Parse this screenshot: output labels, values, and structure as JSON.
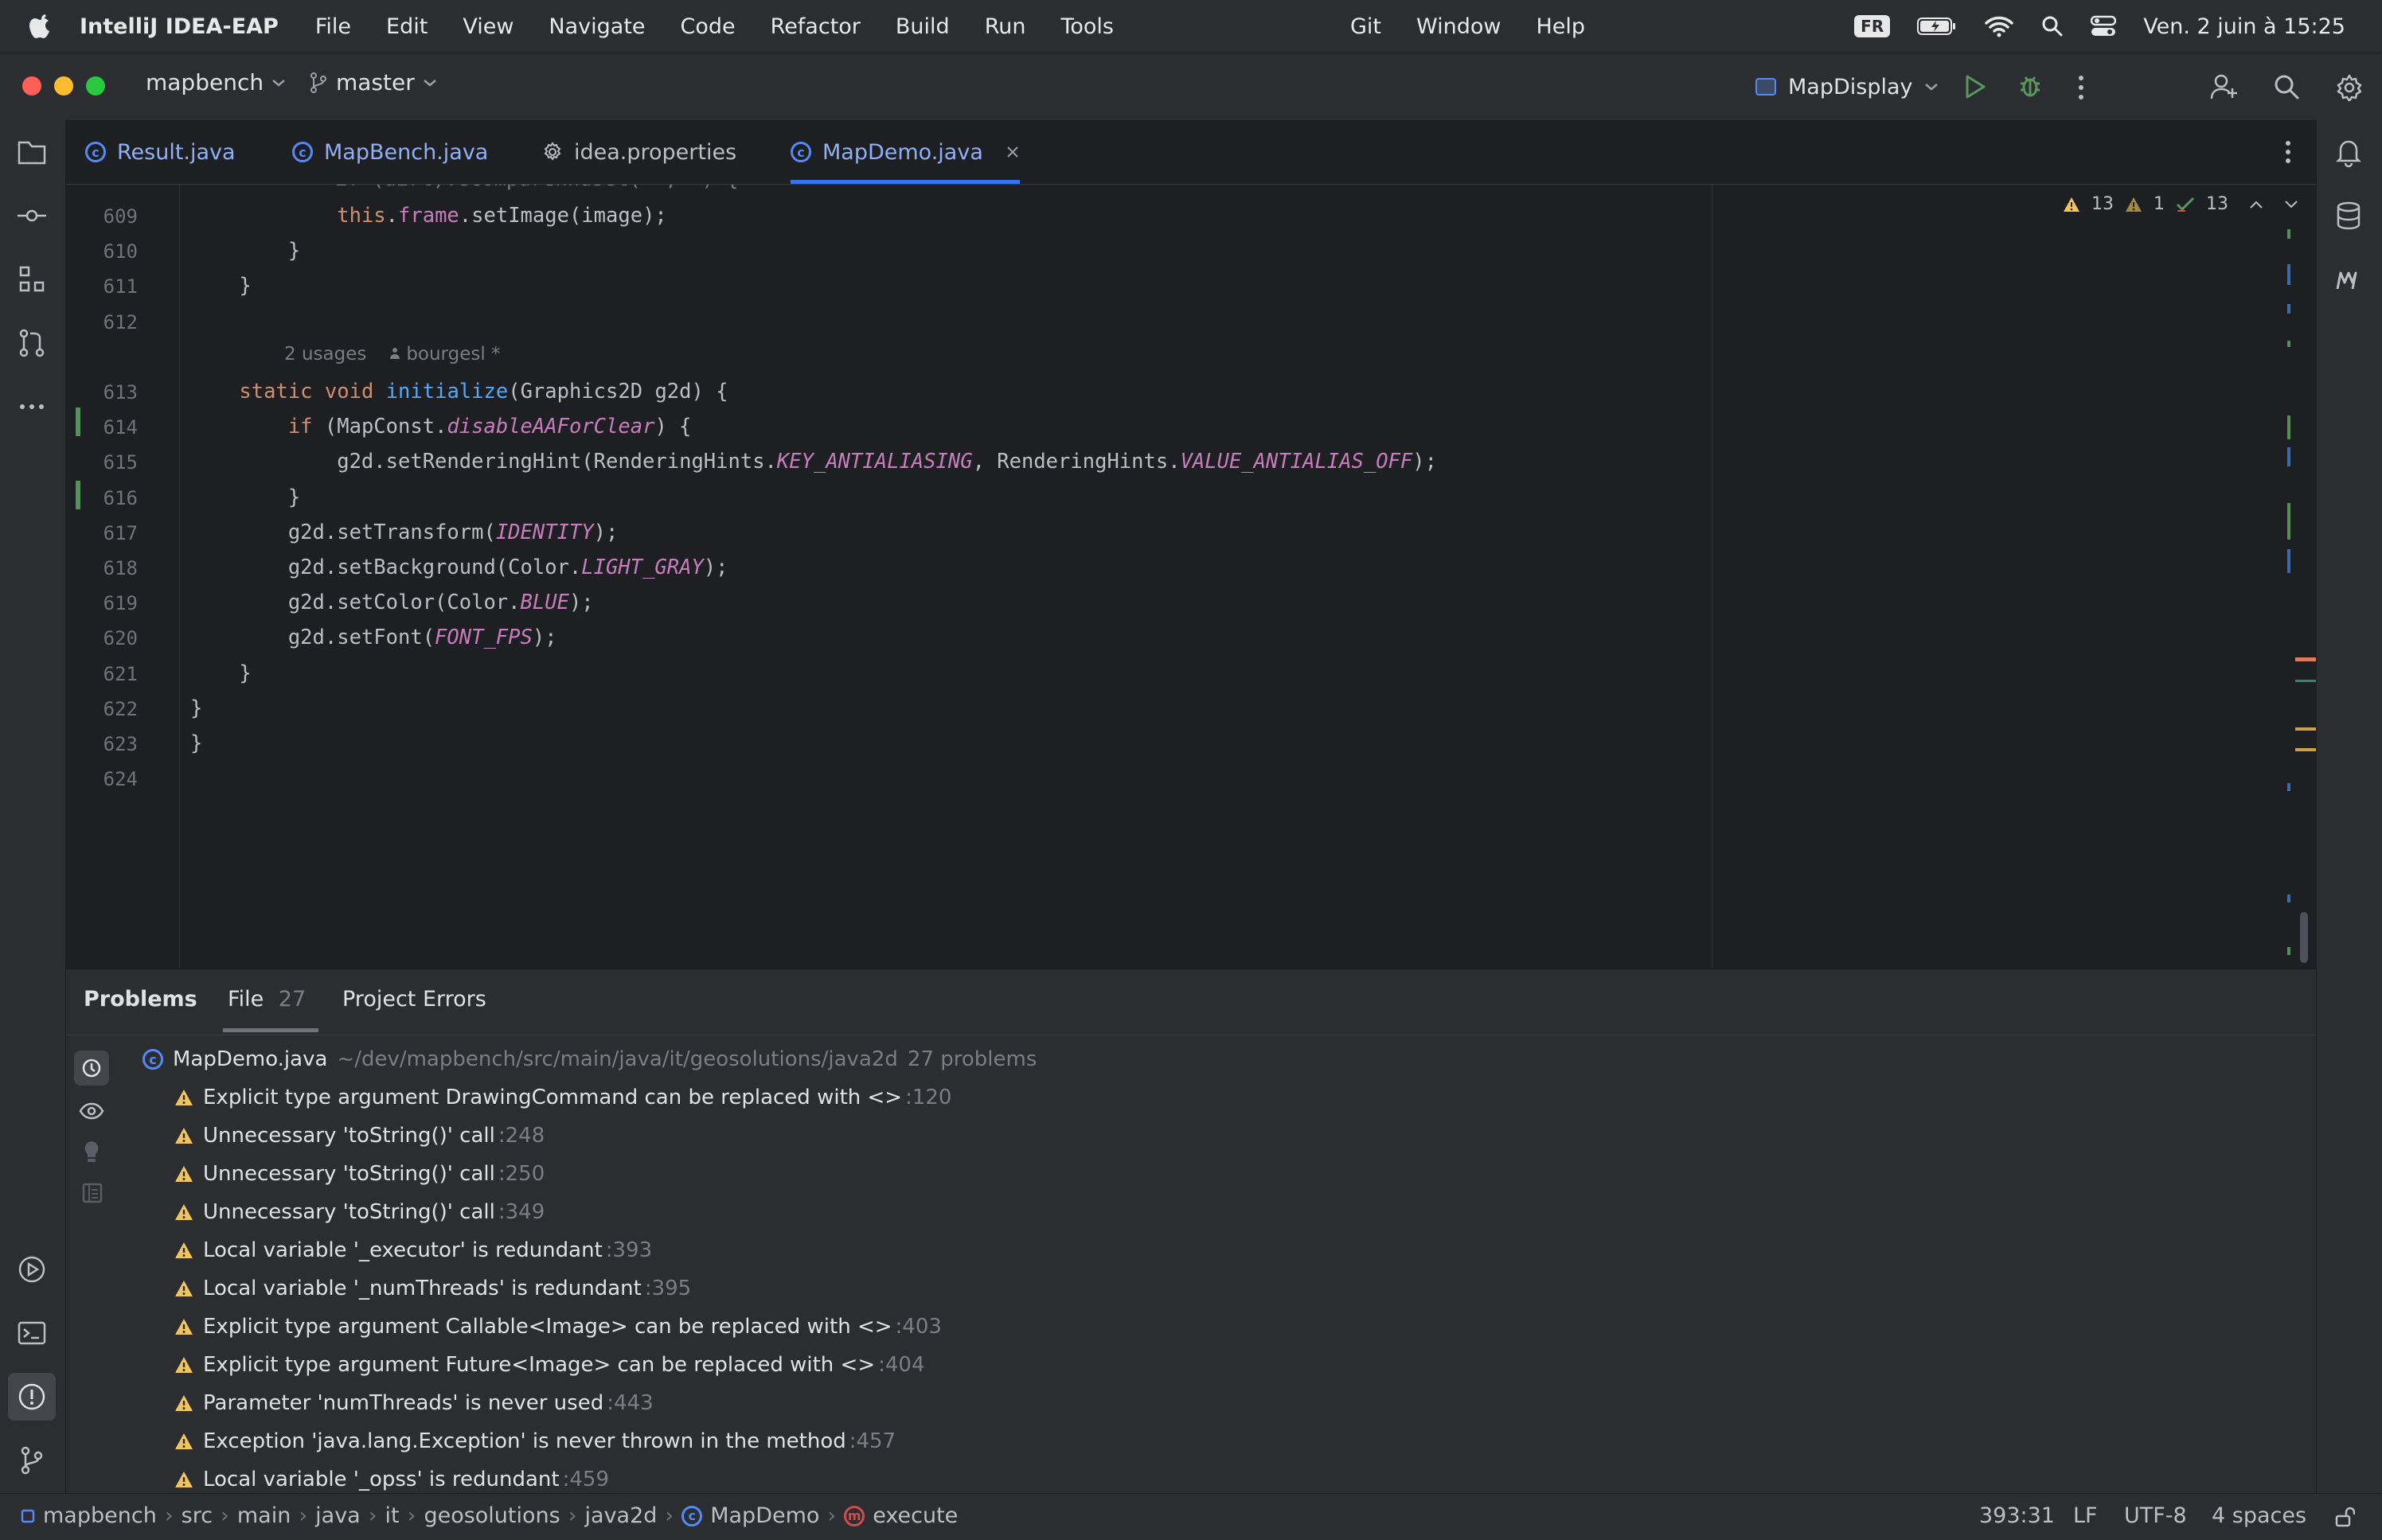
{
  "menubar": {
    "app_name": "IntelliJ IDEA-EAP",
    "items": [
      "File",
      "Edit",
      "View",
      "Navigate",
      "Code",
      "Refactor",
      "Build",
      "Run",
      "Tools"
    ],
    "items_mid": [
      "Git",
      "Window",
      "Help"
    ],
    "input_source": "FR",
    "clock": "Ven. 2 juin à 15:25"
  },
  "titlebar": {
    "project": "mapbench",
    "branch": "master",
    "run_config": "MapDisplay"
  },
  "tabs": [
    {
      "label": "Result.java",
      "type": "class"
    },
    {
      "label": "MapBench.java",
      "type": "class"
    },
    {
      "label": "idea.properties",
      "type": "settings"
    },
    {
      "label": "MapDemo.java",
      "type": "class",
      "active": true
    }
  ],
  "editor": {
    "inspections": {
      "warnings": "13",
      "weak_warnings": "1",
      "typos": "13"
    },
    "lines": [
      {
        "n": "609",
        "code": "            this.frame.setImage(image);"
      },
      {
        "n": "610",
        "code": "        }"
      },
      {
        "n": "611",
        "code": "    }"
      },
      {
        "n": "612",
        "code": ""
      },
      {
        "n": "613",
        "code": "    static void initialize(Graphics2D g2d) {"
      },
      {
        "n": "614",
        "code": "        if (MapConst.disableAAForClear) {"
      },
      {
        "n": "615",
        "code": "            g2d.setRenderingHint(RenderingHints.KEY_ANTIALIASING, RenderingHints.VALUE_ANTIALIAS_OFF);"
      },
      {
        "n": "616",
        "code": "        }"
      },
      {
        "n": "617",
        "code": "        g2d.setTransform(IDENTITY);"
      },
      {
        "n": "618",
        "code": "        g2d.setBackground(Color.LIGHT_GRAY);"
      },
      {
        "n": "619",
        "code": "        g2d.setColor(Color.BLUE);"
      },
      {
        "n": "620",
        "code": "        g2d.setFont(FONT_FPS);"
      },
      {
        "n": "621",
        "code": "    }"
      },
      {
        "n": "622",
        "code": "}"
      },
      {
        "n": "623",
        "code": "}"
      },
      {
        "n": "624",
        "code": ""
      }
    ],
    "hint_usages": "2 usages",
    "hint_author": "bourgesl *"
  },
  "problems": {
    "tabs": [
      {
        "label": "Problems"
      },
      {
        "label": "File",
        "count": "27"
      },
      {
        "label": "Project Errors"
      }
    ],
    "file": {
      "name": "MapDemo.java",
      "path": "~/dev/mapbench/src/main/java/it/geosolutions/java2d",
      "count": "27 problems"
    },
    "items": [
      {
        "text": "Explicit type argument DrawingCommand can be replaced with <>",
        "loc": ":120"
      },
      {
        "text": "Unnecessary 'toString()' call",
        "loc": ":248"
      },
      {
        "text": "Unnecessary 'toString()' call",
        "loc": ":250"
      },
      {
        "text": "Unnecessary 'toString()' call",
        "loc": ":349"
      },
      {
        "text": "Local variable '_executor' is redundant",
        "loc": ":393"
      },
      {
        "text": "Local variable '_numThreads' is redundant",
        "loc": ":395"
      },
      {
        "text": "Explicit type argument Callable<Image> can be replaced with <>",
        "loc": ":403"
      },
      {
        "text": "Explicit type argument Future<Image> can be replaced with <>",
        "loc": ":404"
      },
      {
        "text": "Parameter 'numThreads' is never used",
        "loc": ":443"
      },
      {
        "text": "Exception 'java.lang.Exception' is never thrown in the method",
        "loc": ":457"
      },
      {
        "text": "Local variable '_opss' is redundant",
        "loc": ":459"
      }
    ]
  },
  "statusbar": {
    "breadcrumb": [
      "mapbench",
      "src",
      "main",
      "java",
      "it",
      "geosolutions",
      "java2d",
      "MapDemo",
      "execute"
    ],
    "position": "393:31",
    "line_sep": "LF",
    "encoding": "UTF-8",
    "indent": "4 spaces"
  },
  "colors": {
    "accent": "#3574f0",
    "warning": "#f2c55c",
    "vcs_added": "#549159"
  }
}
